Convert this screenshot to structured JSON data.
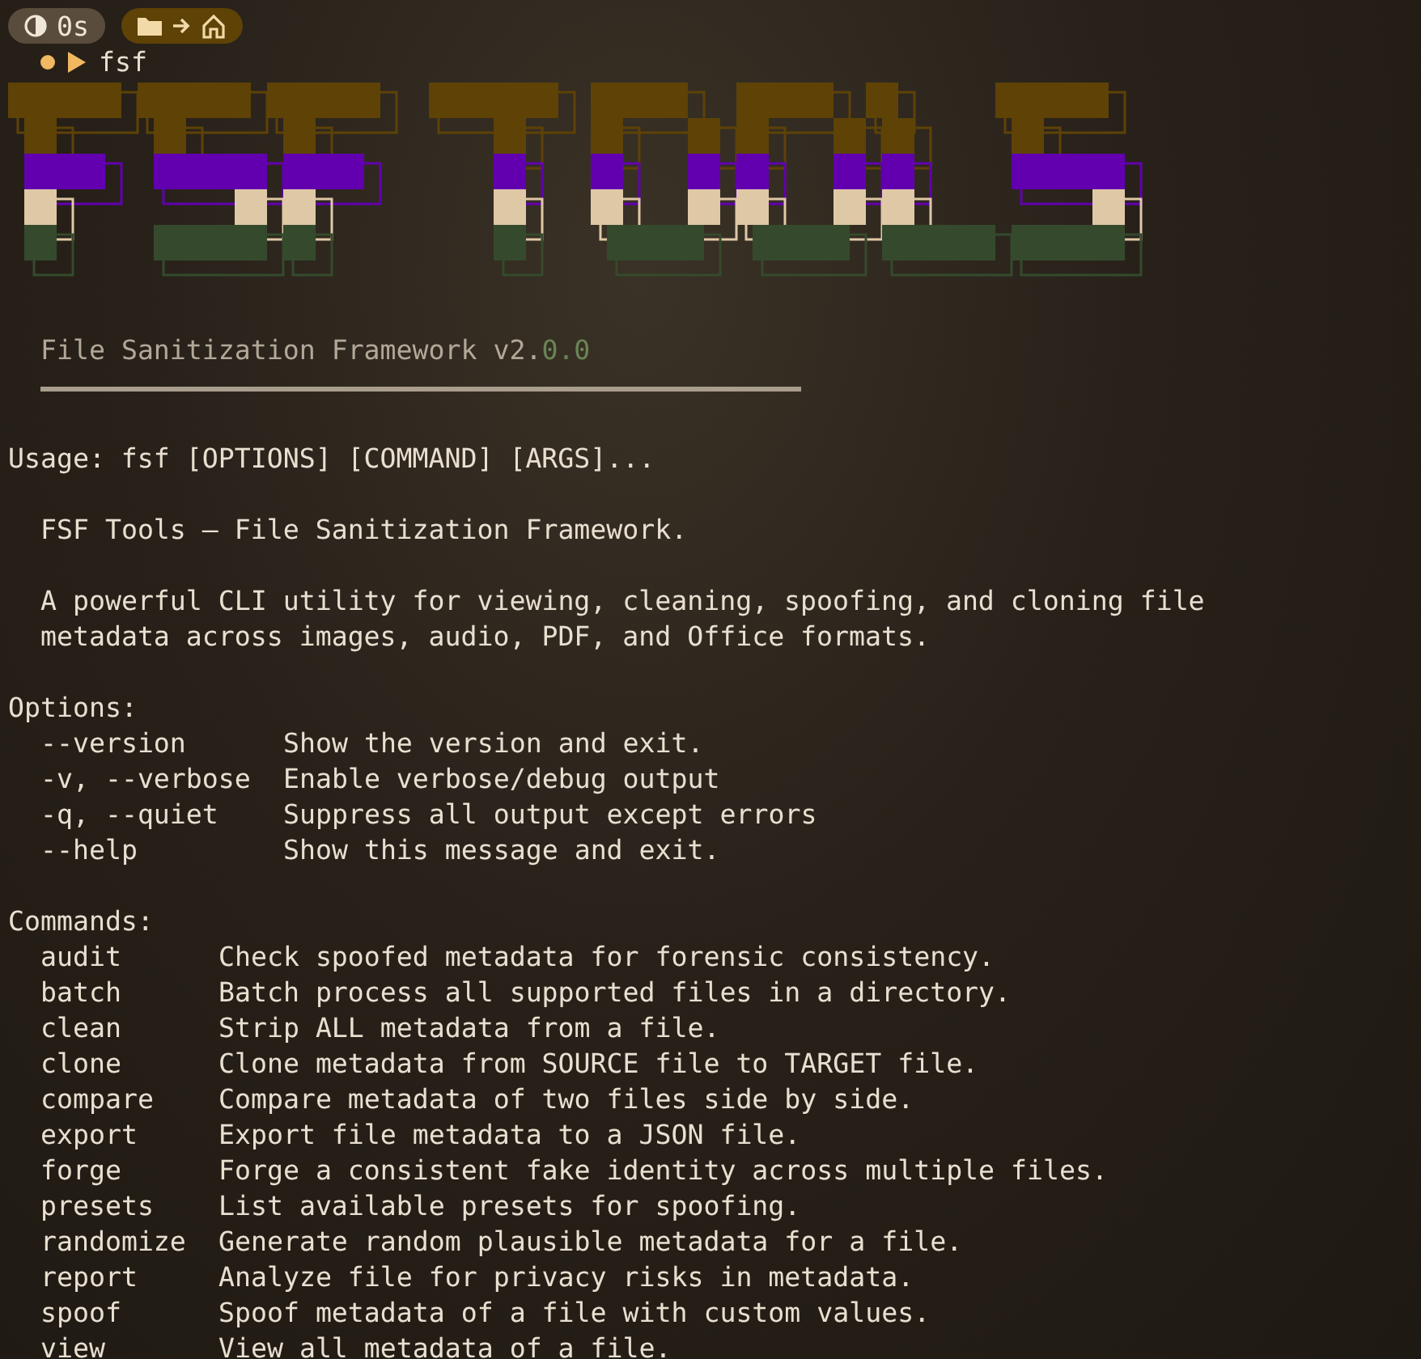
{
  "prompt": {
    "duration": "0s",
    "command": "fsf"
  },
  "banner": {
    "subtitle": "File Sanitization Framework v2.",
    "subtitle_dim": "0.0"
  },
  "usage": "Usage: fsf [OPTIONS] [COMMAND] [ARGS]...",
  "description": [
    "FSF Tools — File Sanitization Framework.",
    "A powerful CLI utility for viewing, cleaning, spoofing, and cloning file\nmetadata across images, audio, PDF, and Office formats."
  ],
  "options": {
    "heading": "Options:",
    "items": [
      {
        "flag": "--version",
        "help": "Show the version and exit."
      },
      {
        "flag": "-v, --verbose",
        "help": "Enable verbose/debug output"
      },
      {
        "flag": "-q, --quiet",
        "help": "Suppress all output except errors"
      },
      {
        "flag": "--help",
        "help": "Show this message and exit."
      }
    ]
  },
  "commands": {
    "heading": "Commands:",
    "items": [
      {
        "name": "audit",
        "help": "Check spoofed metadata for forensic consistency."
      },
      {
        "name": "batch",
        "help": "Batch process all supported files in a directory."
      },
      {
        "name": "clean",
        "help": "Strip ALL metadata from a file."
      },
      {
        "name": "clone",
        "help": "Clone metadata from SOURCE file to TARGET file."
      },
      {
        "name": "compare",
        "help": "Compare metadata of two files side by side."
      },
      {
        "name": "export",
        "help": "Export file metadata to a JSON file."
      },
      {
        "name": "forge",
        "help": "Forge a consistent fake identity across multiple files."
      },
      {
        "name": "presets",
        "help": "List available presets for spoofing."
      },
      {
        "name": "randomize",
        "help": "Generate random plausible metadata for a file."
      },
      {
        "name": "report",
        "help": "Analyze file for privacy risks in metadata."
      },
      {
        "name": "spoof",
        "help": "Spoof metadata of a file with custom values."
      },
      {
        "name": "view",
        "help": "View all metadata of a file."
      }
    ]
  }
}
